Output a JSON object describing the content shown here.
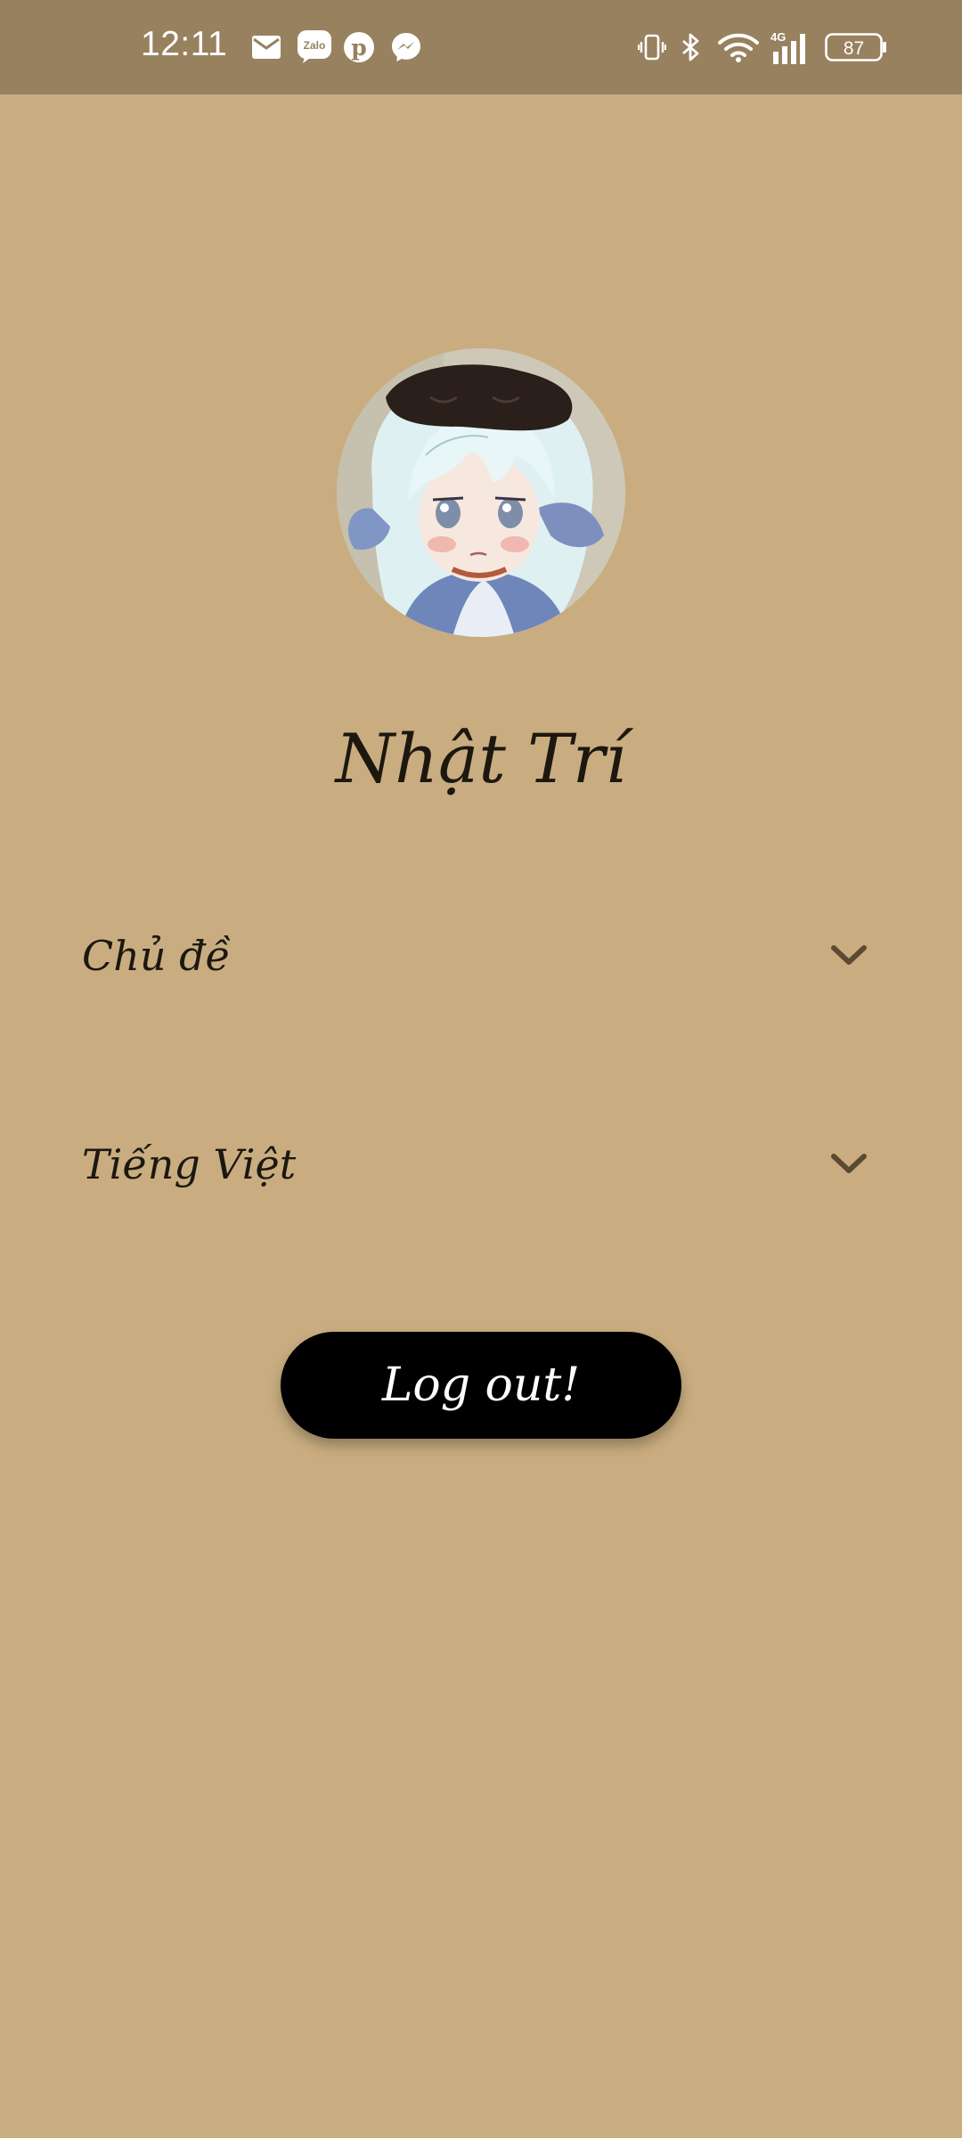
{
  "status_bar": {
    "time": "12:11",
    "battery": "87",
    "network": "4G",
    "notification_icons": [
      "mail-icon",
      "zalo-icon",
      "pinterest-icon",
      "messenger-icon"
    ],
    "system_icons": [
      "vibrate-icon",
      "bluetooth-icon",
      "wifi-icon",
      "signal-icon",
      "battery-icon"
    ]
  },
  "profile": {
    "name": "Nhật Trí"
  },
  "settings": {
    "theme_label": "Chủ đề",
    "language_label": "Tiếng Việt"
  },
  "actions": {
    "logout_label": "Log out!"
  },
  "colors": {
    "background": "#c9ad80",
    "status_bar": "#98815f",
    "button": "#000000",
    "text": "#1c1810",
    "chevron": "#5a4a34"
  }
}
